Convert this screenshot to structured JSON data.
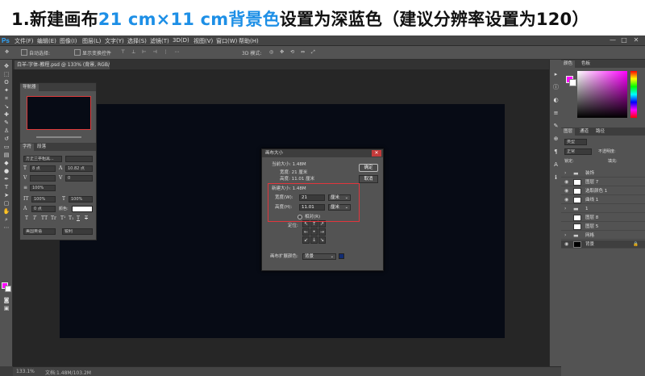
{
  "banner": {
    "part1": "1.新建画布",
    "size_highlight": "21 cm×11 cm背景色",
    "part2": "设置为深蓝色（建议分辨率设置为120）"
  },
  "app": {
    "logo": "Ps",
    "menu": [
      "文件(F)",
      "编辑(E)",
      "图像(I)",
      "图层(L)",
      "文字(Y)",
      "选择(S)",
      "滤镜(T)",
      "3D(D)",
      "视图(V)",
      "窗口(W)",
      "帮助(H)"
    ],
    "window_controls": [
      "—",
      "□",
      "✕"
    ]
  },
  "options_bar": {
    "auto_select_label": "自动选择:",
    "show_transform_label": "显示变换控件",
    "mode_3d_label": "3D 模式:"
  },
  "document_tab": {
    "label": "白羊-字体-教程.psd @ 133% (背景, RGB/8) *"
  },
  "status_bar": {
    "zoom": "133.1%",
    "doc_size": "文档:1.48M/103.2M"
  },
  "navigator_panel": {
    "tabs": [
      "导航器"
    ],
    "char_tabs": [
      "字符",
      "段落"
    ],
    "font_family": "方正兰亭粗黑...",
    "font_size": "8 点",
    "leading": "10.82 点",
    "tracking": "0",
    "scale": "100%",
    "baseline": "0 点",
    "color_label": "颜色:",
    "language": "美国英语",
    "anti_alias": "锐利",
    "type_styles": [
      "T",
      "T",
      "TT",
      "Tr",
      "T¹",
      "T₁",
      "T",
      "T"
    ]
  },
  "right_panel": {
    "color_tabs": [
      "颜色",
      "色板"
    ],
    "layers_tabs": [
      "图层",
      "通道",
      "路径"
    ],
    "kind_label": "类型",
    "blend_mode": "正常",
    "opacity_label": "不透明度:",
    "lock_label": "锁定:",
    "fill_label": "填充:",
    "layers": [
      {
        "name": "装饰",
        "thumb": "folder"
      },
      {
        "name": "图层 7",
        "thumb": "white"
      },
      {
        "name": "选取颜色 1",
        "thumb": "white"
      },
      {
        "name": "曲线 1",
        "thumb": "white"
      },
      {
        "name": "1",
        "thumb": "folder"
      },
      {
        "name": "图层 8",
        "thumb": "white"
      },
      {
        "name": "图层 5",
        "thumb": "white"
      },
      {
        "name": "网格",
        "thumb": "folder"
      },
      {
        "name": "背景",
        "thumb": "dark",
        "lock": "🔒"
      }
    ]
  },
  "dialog": {
    "title": "画布大小",
    "current_size_label": "当前大小: 1.48M",
    "current_width": "宽度:  21 厘米",
    "current_height": "高度:  11.01 厘米",
    "ok_button": "确定",
    "cancel_button": "取消",
    "new_size_label": "新建大小: 1.48M",
    "width_label": "宽度(W):",
    "width_value": "21",
    "width_unit": "厘米",
    "height_label": "高度(H):",
    "height_value": "11.01",
    "height_unit": "厘米",
    "relative_label": "相对(R)",
    "anchor_label": "定位:",
    "anchor_arrows": [
      "↖",
      "↑",
      "↗",
      "←",
      "•",
      "→",
      "↙",
      "↓",
      "↘"
    ],
    "extension_color_label": "画布扩展颜色:",
    "extension_color_value": "背景",
    "extension_color_hex": "#112c73"
  }
}
